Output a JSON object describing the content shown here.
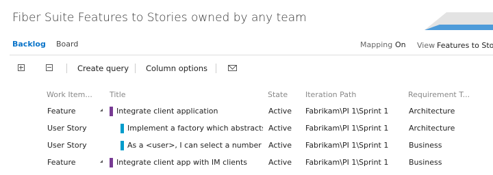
{
  "header": {
    "title": "Fiber Suite Features to Stories owned by any team"
  },
  "tabs": [
    {
      "label": "Backlog",
      "active": true
    },
    {
      "label": "Board",
      "active": false
    }
  ],
  "mapping": {
    "label": "Mapping",
    "value": "On"
  },
  "view": {
    "label": "View",
    "value": "Features to Sto"
  },
  "toolbar": {
    "expand_icon": "expand-all-icon",
    "collapse_icon": "collapse-all-icon",
    "create_query": "Create query",
    "column_options": "Column options",
    "mail_icon": "mail-icon"
  },
  "table": {
    "headers": [
      "Work Item...",
      "Title",
      "State",
      "Iteration Path",
      "Requirement T..."
    ],
    "rows": [
      {
        "type": "Feature",
        "title": "Integrate client application",
        "state": "Active",
        "iteration": "Fabrikam\\PI 1\\Sprint 1",
        "requirement": "Architecture",
        "color": "#773b93"
      },
      {
        "type": "User Story",
        "title": "Implement a factory which abstracts",
        "state": "Active",
        "iteration": "Fabrikam\\PI 1\\Sprint 1",
        "requirement": "Architecture",
        "color": "#009ccc"
      },
      {
        "type": "User Story",
        "title": "As a <user>, I can select a number ...",
        "state": "Active",
        "iteration": "Fabrikam\\PI 1\\Sprint 1",
        "requirement": "Business",
        "color": "#009ccc"
      },
      {
        "type": "Feature",
        "title": "Integrate client app with IM clients",
        "state": "Active",
        "iteration": "Fabrikam\\PI 1\\Sprint 1",
        "requirement": "Business",
        "color": "#773b93"
      }
    ]
  },
  "colors": {
    "accent": "#0a74c9",
    "feature": "#773b93",
    "story": "#009ccc"
  }
}
